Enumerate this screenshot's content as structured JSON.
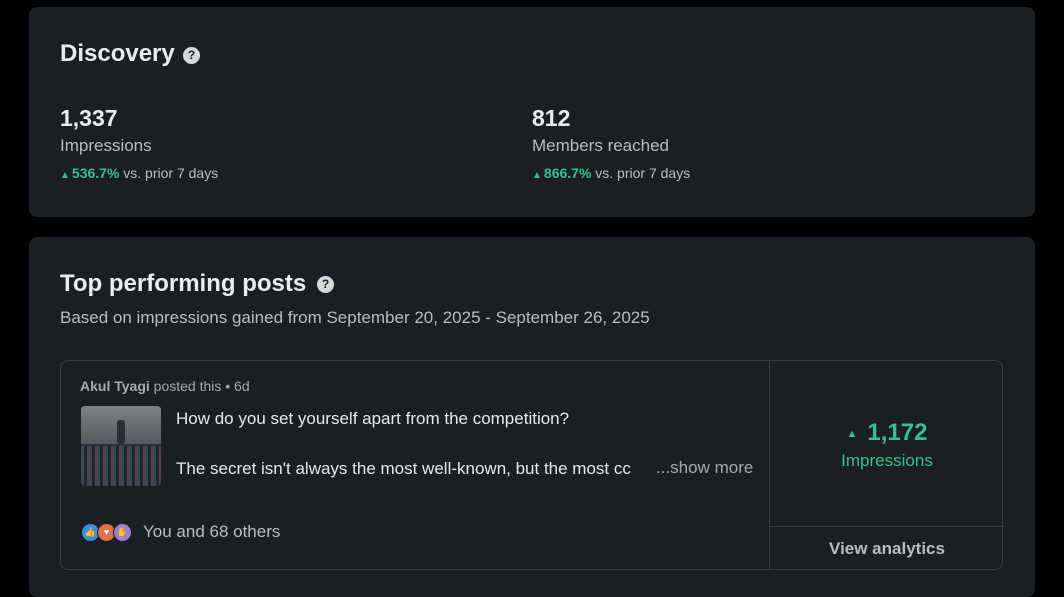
{
  "discovery": {
    "title": "Discovery",
    "help_icon": "question-circle-icon",
    "stats": [
      {
        "value": "1,337",
        "label": "Impressions",
        "delta": "536.7%",
        "delta_suffix": "vs. prior 7 days"
      },
      {
        "value": "812",
        "label": "Members reached",
        "delta": "866.7%",
        "delta_suffix": "vs. prior 7 days"
      }
    ]
  },
  "top_posts": {
    "title": "Top performing posts",
    "subtitle": "Based on impressions gained from September 20, 2025 - September 26, 2025",
    "post": {
      "author": "Akul Tyagi",
      "posted_text": "posted this • 6d",
      "line1": "How do you set yourself apart from the competition?",
      "line2": "The secret isn't always the most well-known, but the most cc",
      "show_more": "...show more",
      "reactions_text": "You and 68 others",
      "reaction_icons": [
        "like-icon",
        "love-icon",
        "support-icon"
      ],
      "metric_value": "1,172",
      "metric_label": "Impressions",
      "view_analytics": "View analytics"
    }
  },
  "colors": {
    "background": "#000000",
    "card": "#1b1f23",
    "positive": "#36c08a",
    "border": "#3a3e43"
  }
}
